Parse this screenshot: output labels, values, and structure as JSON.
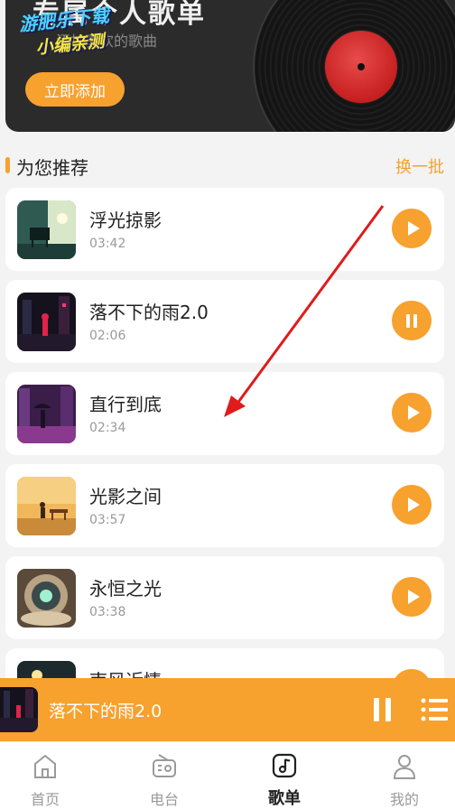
{
  "banner": {
    "title": "专属个人歌单",
    "subtitle": "添加喜欢的歌曲",
    "add_label": "立即添加",
    "watermark_line1": "游肥乐下载",
    "watermark_line2": "小编亲测"
  },
  "section": {
    "title": "为您推荐",
    "refresh_label": "换一批"
  },
  "songs": [
    {
      "title": "浮光掠影",
      "duration": "03:42",
      "state": "paused-play"
    },
    {
      "title": "落不下的雨2.0",
      "duration": "02:06",
      "state": "playing"
    },
    {
      "title": "直行到底",
      "duration": "02:34",
      "state": "paused-play"
    },
    {
      "title": "光影之间",
      "duration": "03:57",
      "state": "paused-play"
    },
    {
      "title": "永恒之光",
      "duration": "03:38",
      "state": "paused-play"
    },
    {
      "title": "南风近情",
      "duration": "",
      "state": "paused-play"
    }
  ],
  "player": {
    "title": "落不下的雨2.0"
  },
  "tabs": [
    {
      "label": "首页",
      "icon": "home-icon"
    },
    {
      "label": "电台",
      "icon": "radio-icon"
    },
    {
      "label": "歌单",
      "icon": "music-note-icon",
      "active": true
    },
    {
      "label": "我的",
      "icon": "person-icon"
    }
  ],
  "colors": {
    "accent": "#f7a12e",
    "annotation_arrow": "#e01b1b"
  }
}
